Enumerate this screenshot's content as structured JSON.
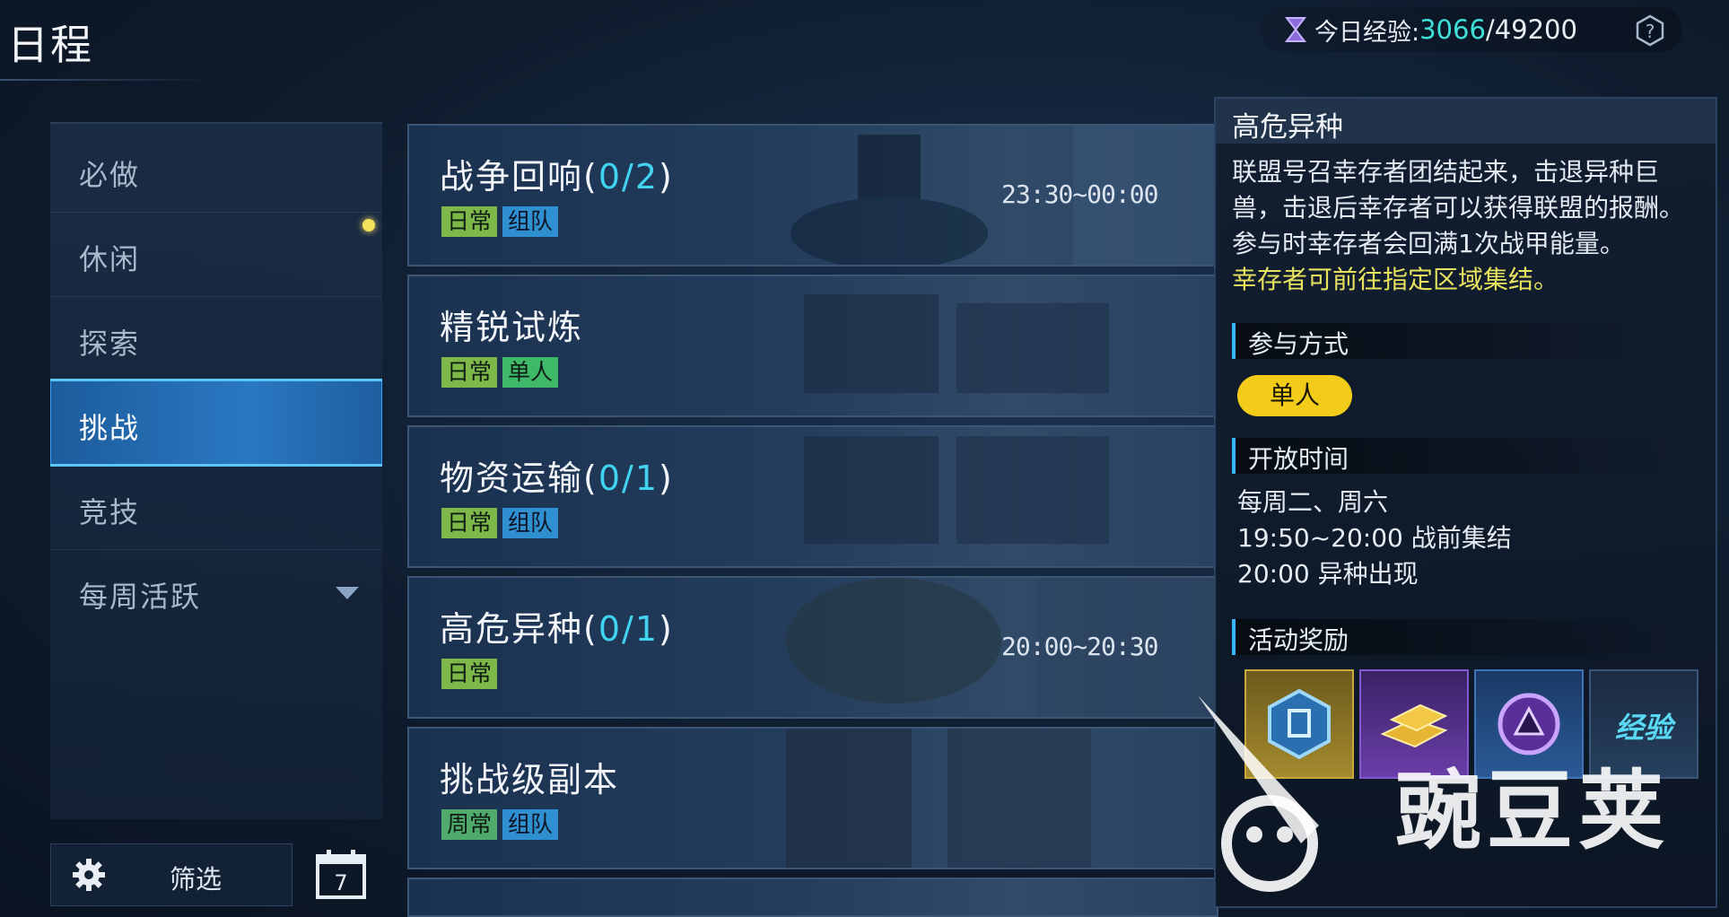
{
  "page": {
    "title": "日程"
  },
  "exp": {
    "label": "今日经验:",
    "current": "3066",
    "separator": "/",
    "max": "49200"
  },
  "sidebar": {
    "items": [
      {
        "label": "必做"
      },
      {
        "label": "休闲"
      },
      {
        "label": "探索"
      },
      {
        "label": "挑战",
        "active": true
      },
      {
        "label": "竞技"
      },
      {
        "label": "每周活跃"
      }
    ],
    "filter_label": "筛选",
    "calendar_day": "7"
  },
  "activities": [
    {
      "name": "战争回响",
      "open": "(",
      "progress": "0/2",
      "close": ")",
      "tags": [
        "日常",
        "组队"
      ],
      "time": "23:30~00:00"
    },
    {
      "name": "精锐试炼",
      "tags": [
        "日常",
        "单人"
      ],
      "time": ""
    },
    {
      "name": "物资运输",
      "open": "(",
      "progress": "0/1",
      "close": ")",
      "tags": [
        "日常",
        "组队"
      ],
      "time": ""
    },
    {
      "name": "高危异种",
      "open": "(",
      "progress": "0/1",
      "close": ")",
      "tags": [
        "日常"
      ],
      "time": "20:00~20:30"
    },
    {
      "name": "挑战级副本",
      "tags": [
        "周常",
        "组队"
      ],
      "time": ""
    }
  ],
  "detail": {
    "title": "高危异种",
    "description": "联盟号召幸存者团结起来，击退异种巨兽，击退后幸存者可以获得联盟的报酬。参与时幸存者会回满1次战甲能量。",
    "highlight": "幸存者可前往指定区域集结。",
    "mode_section": "参与方式",
    "mode": "单人",
    "open_section": "开放时间",
    "open_lines": [
      "每周二、周六",
      "19:50~20:00 战前集结",
      "20:00 异种出现"
    ],
    "reward_section": "活动奖励",
    "rewards": [
      {
        "icon": "blue-core-icon"
      },
      {
        "icon": "gold-bars-icon"
      },
      {
        "icon": "purple-orb-icon"
      },
      {
        "label": "经验"
      }
    ]
  },
  "watermark": {
    "text": "豌豆荚"
  },
  "colors": {
    "accent": "#39b4ff",
    "progress": "#41d3f0",
    "exp": "#3ee0d8",
    "highlight": "#e8e35e",
    "pill": "#f3cc1a"
  }
}
